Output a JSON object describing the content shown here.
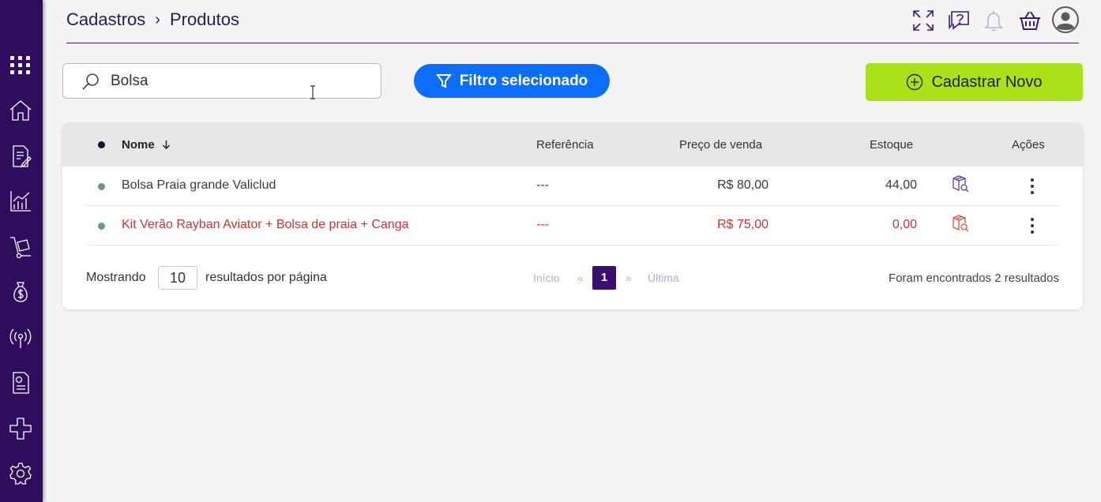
{
  "breadcrumb": {
    "parent": "Cadastros",
    "separator": "›",
    "current": "Produtos"
  },
  "sidebar": {
    "items": [
      {
        "icon": "apps-grid-icon"
      },
      {
        "icon": "home-icon"
      },
      {
        "icon": "document-edit-icon"
      },
      {
        "icon": "chart-icon"
      },
      {
        "icon": "hand-truck-icon"
      },
      {
        "icon": "money-bag-icon"
      },
      {
        "icon": "broadcast-icon"
      },
      {
        "icon": "report-icon"
      },
      {
        "icon": "integrations-icon"
      },
      {
        "icon": "gear-icon"
      }
    ],
    "background": "#2e0d5e"
  },
  "header_icons": [
    "expand-icon",
    "help-icon",
    "bell-icon",
    "basket-icon",
    "user-avatar-icon"
  ],
  "search": {
    "value": "Bolsa",
    "placeholder": ""
  },
  "filter_button": {
    "label": "Filtro selecionado"
  },
  "new_button": {
    "label": "Cadastrar Novo"
  },
  "table": {
    "columns": {
      "name": "Nome",
      "reference": "Referência",
      "price": "Preço de venda",
      "stock": "Estoque",
      "actions": "Ações"
    },
    "rows": [
      {
        "name": "Bolsa Praia grande Valiclud",
        "reference": "---",
        "price": "R$ 80,00",
        "stock": "44,00",
        "status": "normal"
      },
      {
        "name": "Kit Verão Rayban Aviator + Bolsa de praia + Canga",
        "reference": "---",
        "price": "R$ 75,00",
        "stock": "0,00",
        "status": "out-of-stock"
      }
    ]
  },
  "pagination": {
    "showing_label": "Mostrando",
    "per_page": "10",
    "per_page_label": "resultados por página",
    "first": "Início",
    "prev": "«",
    "current": "1",
    "next": "»",
    "last": "Última",
    "found": "Foram encontrados 2 resultados"
  },
  "colors": {
    "accent": "#3a0f6e",
    "filter": "#0d6efd",
    "new_button": "#a9e11a",
    "out_of_stock": "#d32f2f",
    "status_dot": "#6a9a7a"
  }
}
